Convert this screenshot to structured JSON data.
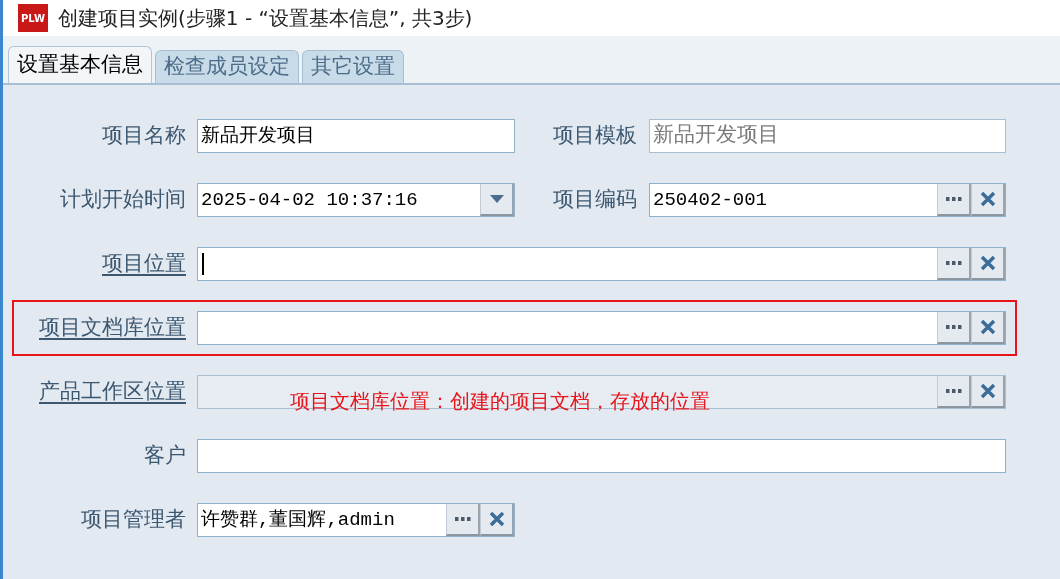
{
  "window": {
    "icon_text": "PLW",
    "title": "创建项目实例(步骤1 - “设置基本信息”, 共3步)"
  },
  "tabs": [
    {
      "label": "设置基本信息",
      "selected": true
    },
    {
      "label": "检查成员设定",
      "selected": false
    },
    {
      "label": "其它设置",
      "selected": false
    }
  ],
  "rows": [
    {
      "highlighted": false,
      "fields": [
        {
          "label": "项目名称",
          "value": "新品开发项目",
          "kind": "text",
          "link": false,
          "disabled": false,
          "focused": false,
          "compact": true
        },
        {
          "label": "项目模板",
          "value": "新品开发项目",
          "kind": "text",
          "link": false,
          "disabled": true,
          "focused": false,
          "compact": false
        }
      ]
    },
    {
      "highlighted": false,
      "fields": [
        {
          "label": "计划开始时间",
          "value": "2025-04-02 10:37:16",
          "kind": "date",
          "link": false,
          "disabled": false,
          "focused": false,
          "compact": true
        },
        {
          "label": "项目编码",
          "value": "250402-001",
          "kind": "picker",
          "link": false,
          "disabled": false,
          "focused": false,
          "compact": false
        }
      ]
    },
    {
      "highlighted": false,
      "fields": [
        {
          "label": "项目位置",
          "kind": "picker",
          "link": true,
          "disabled": false,
          "focused": true,
          "compact": false
        }
      ]
    },
    {
      "highlighted": true,
      "fields": [
        {
          "label": "项目文档库位置",
          "kind": "picker",
          "link": true,
          "disabled": false,
          "focused": false,
          "compact": false
        }
      ]
    },
    {
      "highlighted": false,
      "fields": [
        {
          "label": "产品工作区位置",
          "kind": "picker",
          "link": true,
          "disabled": true,
          "focused": false,
          "compact": false
        }
      ]
    },
    {
      "highlighted": false,
      "fields": [
        {
          "label": "客户",
          "kind": "text",
          "link": false,
          "disabled": false,
          "focused": false,
          "compact": false
        }
      ]
    },
    {
      "highlighted": false,
      "fields": [
        {
          "label": "项目管理者",
          "value": "许赞群,董国辉,admin",
          "kind": "picker",
          "link": false,
          "disabled": false,
          "focused": false,
          "compact": true
        }
      ]
    }
  ],
  "annotation": {
    "text": "项目文档库位置：创建的项目文档，存放的位置"
  }
}
